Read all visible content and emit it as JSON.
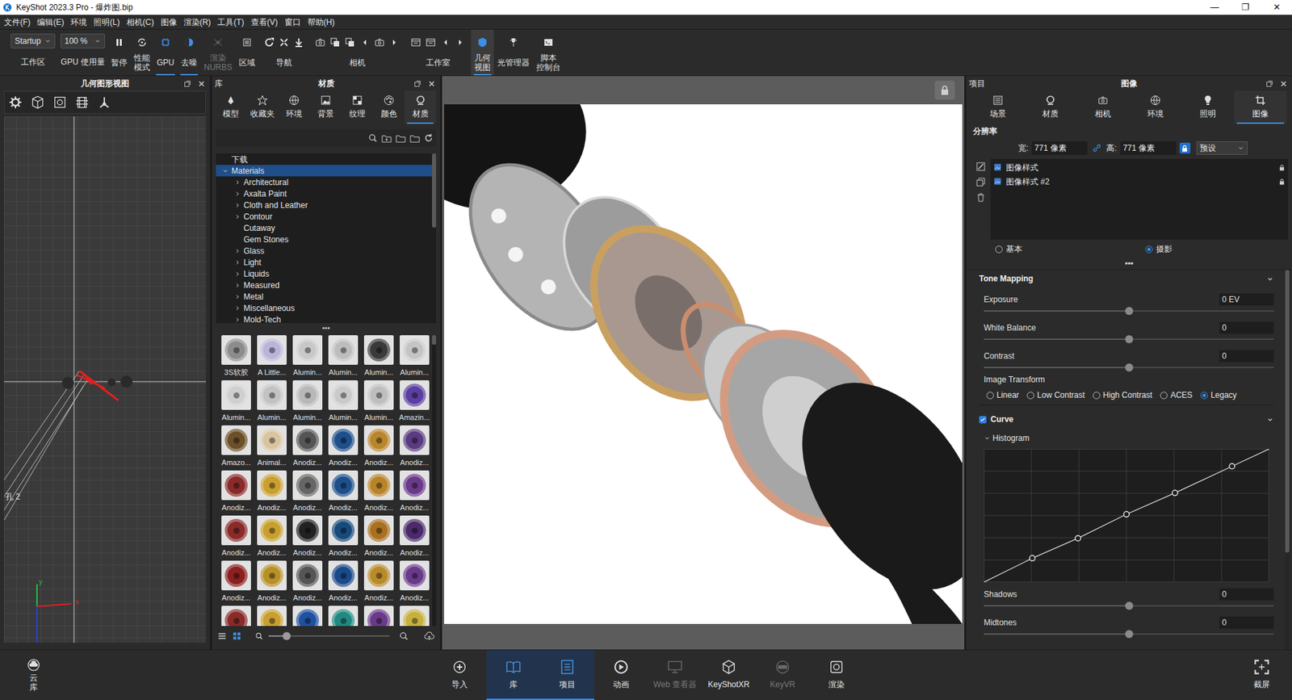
{
  "window": {
    "title": "KeyShot 2023.3 Pro - 爆炸图.bip",
    "controls": [
      "—",
      "❐",
      "✕"
    ]
  },
  "menu": [
    "文件(F)",
    "编辑(E)",
    "环境",
    "照明(L)",
    "相机(C)",
    "图像",
    "渲染(R)",
    "工具(T)",
    "查看(V)",
    "窗口",
    "帮助(H)"
  ],
  "toolbar": {
    "items": [
      {
        "kind": "select",
        "value": "Startup",
        "label": "工作区"
      },
      {
        "kind": "select",
        "value": "100 %",
        "label": "GPU 使用量"
      },
      {
        "kind": "button",
        "label": "暂停",
        "active": false,
        "disabled": false
      },
      {
        "kind": "button",
        "label": "性能\n模式",
        "active": false,
        "disabled": false
      },
      {
        "kind": "button",
        "label": "GPU",
        "active": true,
        "disabled": false
      },
      {
        "kind": "button",
        "label": "去噪",
        "active": true,
        "disabled": false
      },
      {
        "kind": "button",
        "label": "渲染\nNURBS",
        "active": false,
        "disabled": true
      },
      {
        "kind": "button",
        "label": "区域",
        "active": false,
        "disabled": false
      },
      {
        "kind": "group",
        "label": "导航"
      },
      {
        "kind": "group",
        "label": "相机"
      },
      {
        "kind": "group",
        "label": "工作室"
      },
      {
        "kind": "panel",
        "label": "几何\n视图",
        "active": true,
        "disabled": false
      },
      {
        "kind": "panel",
        "label": "光管理器",
        "active": false,
        "disabled": false
      },
      {
        "kind": "panel",
        "label": "脚本\n控制台",
        "active": false,
        "disabled": false
      }
    ]
  },
  "geometry_view": {
    "title": "几何图形视图",
    "label": "孔 2",
    "axes": [
      "y",
      "x"
    ]
  },
  "library": {
    "header": "库",
    "title": "材质",
    "tabs": [
      {
        "label": "模型",
        "selected": false
      },
      {
        "label": "收藏夹",
        "selected": false
      },
      {
        "label": "环境",
        "selected": false
      },
      {
        "label": "背景",
        "selected": false
      },
      {
        "label": "纹理",
        "selected": false
      },
      {
        "label": "颜色",
        "selected": false
      },
      {
        "label": "材质",
        "selected": true
      }
    ],
    "tree": [
      {
        "label": "下载",
        "depth": 0,
        "expandable": false,
        "expanded": false,
        "selected": false
      },
      {
        "label": "Materials",
        "depth": 0,
        "expandable": true,
        "expanded": true,
        "selected": true
      },
      {
        "label": "Architectural",
        "depth": 1,
        "expandable": true,
        "expanded": false,
        "selected": false
      },
      {
        "label": "Axalta Paint",
        "depth": 1,
        "expandable": true,
        "expanded": false,
        "selected": false
      },
      {
        "label": "Cloth and Leather",
        "depth": 1,
        "expandable": true,
        "expanded": false,
        "selected": false
      },
      {
        "label": "Contour",
        "depth": 1,
        "expandable": true,
        "expanded": false,
        "selected": false
      },
      {
        "label": "Cutaway",
        "depth": 1,
        "expandable": false,
        "expanded": false,
        "selected": false
      },
      {
        "label": "Gem Stones",
        "depth": 1,
        "expandable": false,
        "expanded": false,
        "selected": false
      },
      {
        "label": "Glass",
        "depth": 1,
        "expandable": true,
        "expanded": false,
        "selected": false
      },
      {
        "label": "Light",
        "depth": 1,
        "expandable": true,
        "expanded": false,
        "selected": false
      },
      {
        "label": "Liquids",
        "depth": 1,
        "expandable": true,
        "expanded": false,
        "selected": false
      },
      {
        "label": "Measured",
        "depth": 1,
        "expandable": true,
        "expanded": false,
        "selected": false
      },
      {
        "label": "Metal",
        "depth": 1,
        "expandable": true,
        "expanded": false,
        "selected": false
      },
      {
        "label": "Miscellaneous",
        "depth": 1,
        "expandable": true,
        "expanded": false,
        "selected": false
      },
      {
        "label": "Mold-Tech",
        "depth": 1,
        "expandable": true,
        "expanded": false,
        "selected": false
      }
    ],
    "more": "•••",
    "thumbnails": [
      {
        "label": "3S软胶",
        "color": "#8c8c8c"
      },
      {
        "label": "A Little...",
        "color": "#b9b4d9"
      },
      {
        "label": "Alumin...",
        "color": "#c8c8c8"
      },
      {
        "label": "Alumin...",
        "color": "#bdbdbd"
      },
      {
        "label": "Alumin...",
        "color": "#3a3a3a"
      },
      {
        "label": "Alumin...",
        "color": "#c4c4c4"
      },
      {
        "label": "Alumin...",
        "color": "#cfcfcf"
      },
      {
        "label": "Alumin...",
        "color": "#c2c2c2"
      },
      {
        "label": "Alumin...",
        "color": "#b8b8b8"
      },
      {
        "label": "Alumin...",
        "color": "#cacaca"
      },
      {
        "label": "Alumin...",
        "color": "#bebebe"
      },
      {
        "label": "Amazin...",
        "color": "#5b3fa0"
      },
      {
        "label": "Amazo...",
        "color": "#6b5028"
      },
      {
        "label": "Animal...",
        "color": "#d8c4a0"
      },
      {
        "label": "Anodiz...",
        "color": "#555555"
      },
      {
        "label": "Anodiz...",
        "color": "#1f4f8a"
      },
      {
        "label": "Anodiz...",
        "color": "#b8862c"
      },
      {
        "label": "Anodiz...",
        "color": "#5a3a80"
      },
      {
        "label": "Anodiz...",
        "color": "#8a2a2a"
      },
      {
        "label": "Anodiz...",
        "color": "#c9a030"
      },
      {
        "label": "Anodiz...",
        "color": "#666666"
      },
      {
        "label": "Anodiz...",
        "color": "#1e4f8c"
      },
      {
        "label": "Anodiz...",
        "color": "#b8842a"
      },
      {
        "label": "Anodiz...",
        "color": "#6a3a8a"
      },
      {
        "label": "Anodiz...",
        "color": "#8a2a2a"
      },
      {
        "label": "Anodiz...",
        "color": "#c8a030"
      },
      {
        "label": "Anodiz...",
        "color": "#222222"
      },
      {
        "label": "Anodiz...",
        "color": "#174a7a"
      },
      {
        "label": "Anodiz...",
        "color": "#a87020"
      },
      {
        "label": "Anodiz...",
        "color": "#4a2a6a"
      },
      {
        "label": "Anodiz...",
        "color": "#8a2020"
      },
      {
        "label": "Anodiz...",
        "color": "#b89028"
      },
      {
        "label": "Anodiz...",
        "color": "#555555"
      },
      {
        "label": "Anodiz...",
        "color": "#1a4a8a"
      },
      {
        "label": "Anodiz...",
        "color": "#b88a2a"
      },
      {
        "label": "Anodiz...",
        "color": "#6a3a8a"
      },
      {
        "color": "#8a2a2a"
      },
      {
        "color": "#c9a030"
      },
      {
        "color": "#2050a0"
      },
      {
        "color": "#208a80"
      },
      {
        "color": "#6a3a8a"
      },
      {
        "color": "#c8b040"
      }
    ],
    "zoom": {
      "level": 0.15
    }
  },
  "project": {
    "header": "项目",
    "title": "图像",
    "tabs": [
      {
        "label": "场景",
        "selected": false
      },
      {
        "label": "材质",
        "selected": false
      },
      {
        "label": "相机",
        "selected": false
      },
      {
        "label": "环境",
        "selected": false
      },
      {
        "label": "照明",
        "selected": false
      },
      {
        "label": "图像",
        "selected": true
      }
    ],
    "resolution": {
      "label": "分辨率",
      "width_label": "宽:",
      "width": "771 像素",
      "height_label": "高:",
      "height": "771 像素",
      "linked": true,
      "locked": true,
      "preset": "预设"
    },
    "image_styles": [
      {
        "label": "图像样式",
        "selected": false
      },
      {
        "label": "图像样式 #2",
        "selected": false
      }
    ],
    "modes": [
      {
        "label": "基本",
        "selected": false
      },
      {
        "label": "摄影",
        "selected": true
      }
    ],
    "more": "•••",
    "tone_mapping": {
      "title": "Tone Mapping",
      "expanded": true,
      "sliders": [
        {
          "label": "Exposure",
          "value": "0 EV",
          "level": 0.5
        },
        {
          "label": "White Balance",
          "value": "0",
          "level": 0.5
        },
        {
          "label": "Contrast",
          "value": "0",
          "level": 0.5
        }
      ]
    },
    "image_transform": {
      "label": "Image Transform",
      "options": [
        {
          "label": "Linear",
          "selected": false
        },
        {
          "label": "Low Contrast",
          "selected": false
        },
        {
          "label": "High Contrast",
          "selected": false
        },
        {
          "label": "ACES",
          "selected": false
        },
        {
          "label": "Legacy",
          "selected": true
        }
      ]
    },
    "curve": {
      "label": "Curve",
      "checked": true,
      "expanded": true,
      "histogram_label": "Histogram",
      "histogram_expanded": true,
      "points": [
        [
          0.17,
          0.18
        ],
        [
          0.33,
          0.33
        ],
        [
          0.5,
          0.51
        ],
        [
          0.67,
          0.67
        ],
        [
          0.87,
          0.87
        ]
      ]
    },
    "sliders_bottom": [
      {
        "label": "Shadows",
        "value": "0",
        "level": 0.5
      },
      {
        "label": "Midtones",
        "value": "0",
        "level": 0.5
      }
    ]
  },
  "bottom_bar": {
    "cloud": "云库",
    "items": [
      {
        "label": "导入",
        "selected": false,
        "disabled": false
      },
      {
        "label": "库",
        "selected": true,
        "disabled": false
      },
      {
        "label": "项目",
        "selected": true,
        "disabled": false
      },
      {
        "label": "动画",
        "selected": false,
        "disabled": false
      },
      {
        "label": "Web 查看器",
        "selected": false,
        "disabled": true
      },
      {
        "label": "KeyShotXR",
        "selected": false,
        "disabled": false
      },
      {
        "label": "KeyVR",
        "selected": false,
        "disabled": true
      },
      {
        "label": "渲染",
        "selected": false,
        "disabled": false
      }
    ],
    "screenshot": "截屏"
  }
}
